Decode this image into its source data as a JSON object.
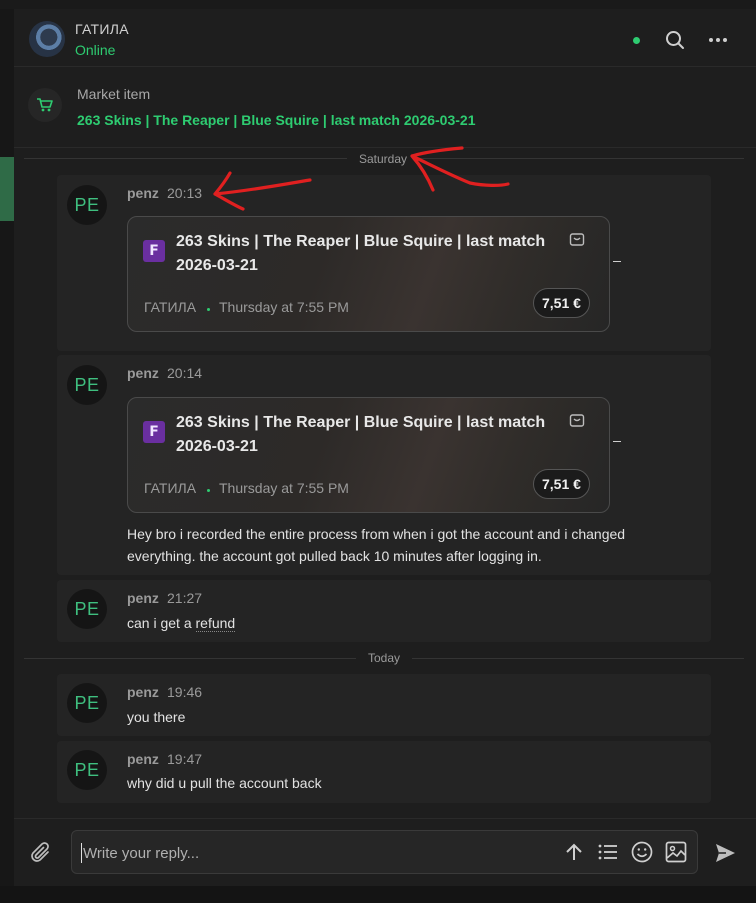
{
  "header": {
    "name": "ГАТИЛА",
    "status": "Online"
  },
  "market": {
    "label": "Market item",
    "title": "263 Skins | The Reaper | Blue Squire | last match 2026-03-21"
  },
  "separators": {
    "saturday": "Saturday",
    "today": "Today"
  },
  "messages": [
    {
      "avatar": "PE",
      "author": "penz",
      "time": "20:13",
      "card": {
        "title": "263 Skins | The Reaper | Blue Squire | last match 2026-03-21",
        "seller": "ГАТИЛА",
        "when": "Thursday at 7:55 PM",
        "price": "7,51 €",
        "logo": "F"
      }
    },
    {
      "avatar": "PE",
      "author": "penz",
      "time": "20:14",
      "card": {
        "title": "263 Skins | The Reaper | Blue Squire | last match 2026-03-21",
        "seller": "ГАТИЛА",
        "when": "Thursday at 7:55 PM",
        "price": "7,51 €",
        "logo": "F"
      },
      "text": "Hey bro i recorded the entire process from when i got the account and i changed everything. the account got pulled back 10 minutes after logging in."
    },
    {
      "avatar": "PE",
      "author": "penz",
      "time": "21:27",
      "text_prefix": "can i get a ",
      "text_link": "refund"
    },
    {
      "avatar": "PE",
      "author": "penz",
      "time": "19:46",
      "text": "you there"
    },
    {
      "avatar": "PE",
      "author": "penz",
      "time": "19:47",
      "text": "why did u pull the account back"
    }
  ],
  "composer": {
    "placeholder": "Write your reply..."
  },
  "icons": {
    "header": [
      "online-indicator",
      "search-icon",
      "more-icon"
    ],
    "market": "cart-icon",
    "composer": [
      "attach-icon",
      "arrow-up-icon",
      "list-icon",
      "emoji-icon",
      "image-icon",
      "send-icon"
    ]
  },
  "colors": {
    "accent": "#2ecc71",
    "annotation": "#e02020"
  }
}
